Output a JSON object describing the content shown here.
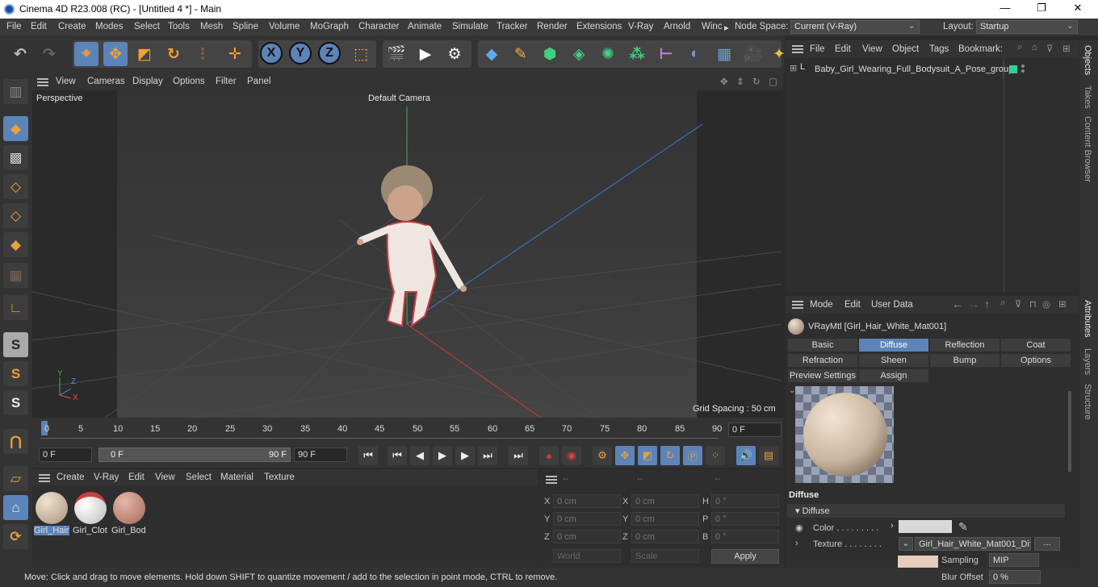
{
  "window": {
    "title": "Cinema 4D R23.008 (RC) - [Untitled 4 *] - Main",
    "minimize": "—",
    "maximize": "❐",
    "close": "✕"
  },
  "menu": {
    "items": [
      "File",
      "Edit",
      "Create",
      "Modes",
      "Select",
      "Tools",
      "Mesh",
      "Spline",
      "Volume",
      "MoGraph",
      "Character",
      "Animate",
      "Simulate",
      "Tracker",
      "Render",
      "Extensions",
      "V-Ray",
      "Arnold",
      "Winc"
    ],
    "more": "▸",
    "node_space_label": "Node Space:",
    "node_space_value": "Current (V-Ray)",
    "layout_label": "Layout:",
    "layout_value": "Startup"
  },
  "toolbar": {
    "undo": "↶",
    "redo": "↷",
    "x": "X",
    "y": "Y",
    "z": "Z"
  },
  "viewport": {
    "menu": [
      "View",
      "Cameras",
      "Display",
      "Options",
      "Filter",
      "Panel"
    ],
    "label": "Perspective",
    "camera": "Default Camera",
    "grid_spacing": "Grid Spacing : 50 cm",
    "axis_y": "Y",
    "axis_z": "Z",
    "axis_x": "X"
  },
  "timeline": {
    "ticks": [
      "0",
      "5",
      "10",
      "15",
      "20",
      "25",
      "30",
      "35",
      "40",
      "45",
      "50",
      "55",
      "60",
      "65",
      "70",
      "75",
      "80",
      "85",
      "90"
    ],
    "current": "0 F"
  },
  "playback": {
    "start": "0 F",
    "range_start": "0 F",
    "range_end": "90 F",
    "end": "90 F"
  },
  "materials": {
    "menu": [
      "Create",
      "V-Ray",
      "Edit",
      "View",
      "Select",
      "Material",
      "Texture"
    ],
    "items": [
      {
        "label": "Girl_Hair"
      },
      {
        "label": "Girl_Clot"
      },
      {
        "label": "Girl_Bod"
      }
    ]
  },
  "coordinates": {
    "header": [
      "--",
      "--",
      "--"
    ],
    "rows": [
      {
        "a": "X",
        "av": "0 cm",
        "b": "X",
        "bv": "0 cm",
        "c": "H",
        "cv": "0 °"
      },
      {
        "a": "Y",
        "av": "0 cm",
        "b": "Y",
        "bv": "0 cm",
        "c": "P",
        "cv": "0 °"
      },
      {
        "a": "Z",
        "av": "0 cm",
        "b": "Z",
        "bv": "0 cm",
        "c": "B",
        "cv": "0 °"
      }
    ],
    "world": "World",
    "scale": "Scale",
    "apply": "Apply"
  },
  "objects": {
    "menu": [
      "File",
      "Edit",
      "View",
      "Object",
      "Tags",
      "Bookmark:"
    ],
    "item": "Baby_Girl_Wearing_Full_Bodysuit_A_Pose_group"
  },
  "attributes": {
    "menu": [
      "Mode",
      "Edit",
      "User Data"
    ],
    "material": "VRayMtl [Girl_Hair_White_Mat001]",
    "tabs": [
      "Basic",
      "Diffuse",
      "Reflection",
      "Coat",
      "Refraction",
      "Sheen",
      "Bump",
      "Options",
      "Preview Settings",
      "Assign"
    ],
    "section": "Diffuse",
    "group": "▾ Diffuse",
    "color_label": "Color . . . . . . . . .",
    "texture_label": "Texture . . . . . . . .",
    "texture_value": "Girl_Hair_White_Mat001_Dif",
    "texture_btn": "...",
    "sampling_label": "Sampling",
    "sampling_value": "MIP",
    "blur_label": "Blur Offset",
    "blur_value": "0 %"
  },
  "sidetabs": [
    "Objects",
    "Takes",
    "Content Browser",
    "Attributes",
    "Layers",
    "Structure"
  ],
  "status": "Move: Click and drag to move elements. Hold down SHIFT to quantize movement / add to the selection in point mode, CTRL to remove."
}
